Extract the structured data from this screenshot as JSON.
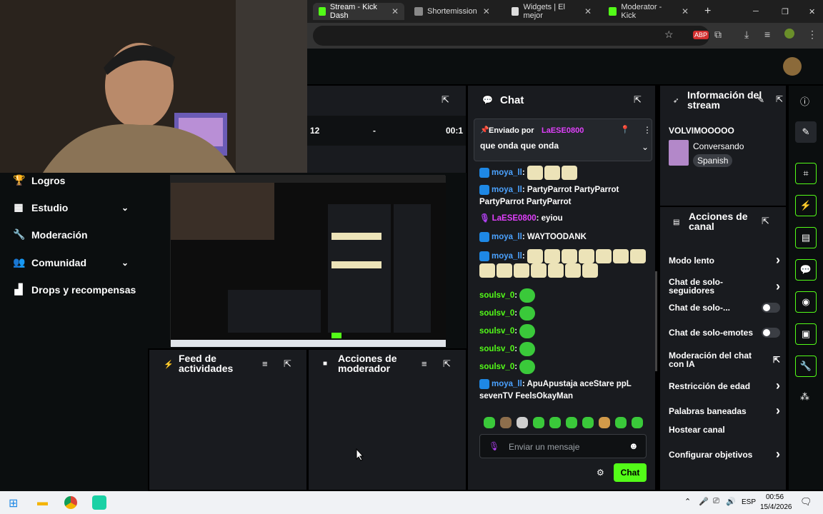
{
  "browser": {
    "tabs": [
      {
        "label": "Stream - Kick Dash",
        "icon_color": "#53fc18",
        "active": true
      },
      {
        "label": "Shortemission",
        "icon_color": "#888888",
        "active": false
      },
      {
        "label": "Widgets | El mejor",
        "icon_color": "#dddddd",
        "active": false
      },
      {
        "label": "Moderator - Kick",
        "icon_color": "#53fc18",
        "active": false
      }
    ],
    "new_tab": "+",
    "window_controls": {
      "minimize": "─",
      "restore": "❐",
      "close": "✕"
    },
    "toolbar": {
      "extension_abp": "ABP"
    }
  },
  "sidebar": {
    "items": [
      {
        "label": "Logros",
        "icon": "trophy-icon",
        "glyph": "🏆",
        "expandable": false
      },
      {
        "label": "Estudio",
        "icon": "studio-icon",
        "glyph": "▦",
        "expandable": true
      },
      {
        "label": "Moderación",
        "icon": "wrench-icon",
        "glyph": "🔧",
        "expandable": false
      },
      {
        "label": "Comunidad",
        "icon": "people-icon",
        "glyph": "👥",
        "expandable": true
      },
      {
        "label": "Drops y recompensas",
        "icon": "chart-icon",
        "glyph": "▟",
        "expandable": false
      }
    ]
  },
  "stats_panel": {
    "values": [
      "12",
      "-",
      "00:1"
    ]
  },
  "feed_panel": {
    "title": "Feed de actividades"
  },
  "mod_actions_panel": {
    "title": "Acciones de moderador"
  },
  "chat": {
    "title": "Chat",
    "pinned": {
      "prefix": "Enviado por",
      "user": "LaESE0800",
      "message": "que onda que onda"
    },
    "messages": [
      {
        "user": "moya_ll",
        "text": "",
        "emotes": 3,
        "type": "pepe"
      },
      {
        "user": "moya_ll",
        "text": "PartyParrot PartyParrot PartyParrot PartyParrot",
        "emotes": 0,
        "type": ""
      },
      {
        "user": "LaESE0800",
        "text": "eyiou",
        "emotes": 0,
        "type": ""
      },
      {
        "user": "moya_ll",
        "text": "WAYTOODANK",
        "emotes": 0,
        "type": ""
      },
      {
        "user": "moya_ll",
        "text": "",
        "emotes": 14,
        "type": "pepe"
      },
      {
        "user": "soulsv_0",
        "text": "",
        "emotes": 1,
        "type": "frog"
      },
      {
        "user": "soulsv_0",
        "text": "",
        "emotes": 1,
        "type": "frog"
      },
      {
        "user": "soulsv_0",
        "text": "",
        "emotes": 1,
        "type": "frog"
      },
      {
        "user": "soulsv_0",
        "text": "",
        "emotes": 1,
        "type": "frog"
      },
      {
        "user": "soulsv_0",
        "text": "",
        "emotes": 1,
        "type": "frog"
      },
      {
        "user": "moya_ll",
        "text": "ApuApustaja aceStare ppL sevenTV FeelsOkayMan",
        "emotes": 0,
        "type": ""
      }
    ],
    "input_placeholder": "Enviar un mensaje",
    "send_label": "Chat"
  },
  "stream_info": {
    "title": "Información del stream",
    "stream_title": "VOLVIMOOOOO",
    "category": "Conversando",
    "language": "Spanish"
  },
  "channel_actions": {
    "title": "Acciones de canal",
    "items": [
      {
        "label": "Modo lento",
        "control": "chevron"
      },
      {
        "label": "Chat de solo-seguidores",
        "control": "chevron"
      },
      {
        "label": "Chat de solo-...",
        "control": "toggle"
      },
      {
        "label": "Chat de solo-emotes",
        "control": "toggle"
      },
      {
        "label": "Moderación del chat con IA",
        "control": "external"
      },
      {
        "label": "Restricción de edad",
        "control": "chevron"
      },
      {
        "label": "Palabras baneadas",
        "control": "chevron"
      },
      {
        "label": "Hostear canal",
        "control": "none"
      },
      {
        "label": "Configurar objetivos",
        "control": "chevron"
      }
    ]
  },
  "taskbar": {
    "language": "ESP",
    "time": "00:56",
    "date": "15/4/2026"
  },
  "colors": {
    "accent": "#53fc18",
    "panel": "#191b1f",
    "bg": "#0b0e0f"
  }
}
